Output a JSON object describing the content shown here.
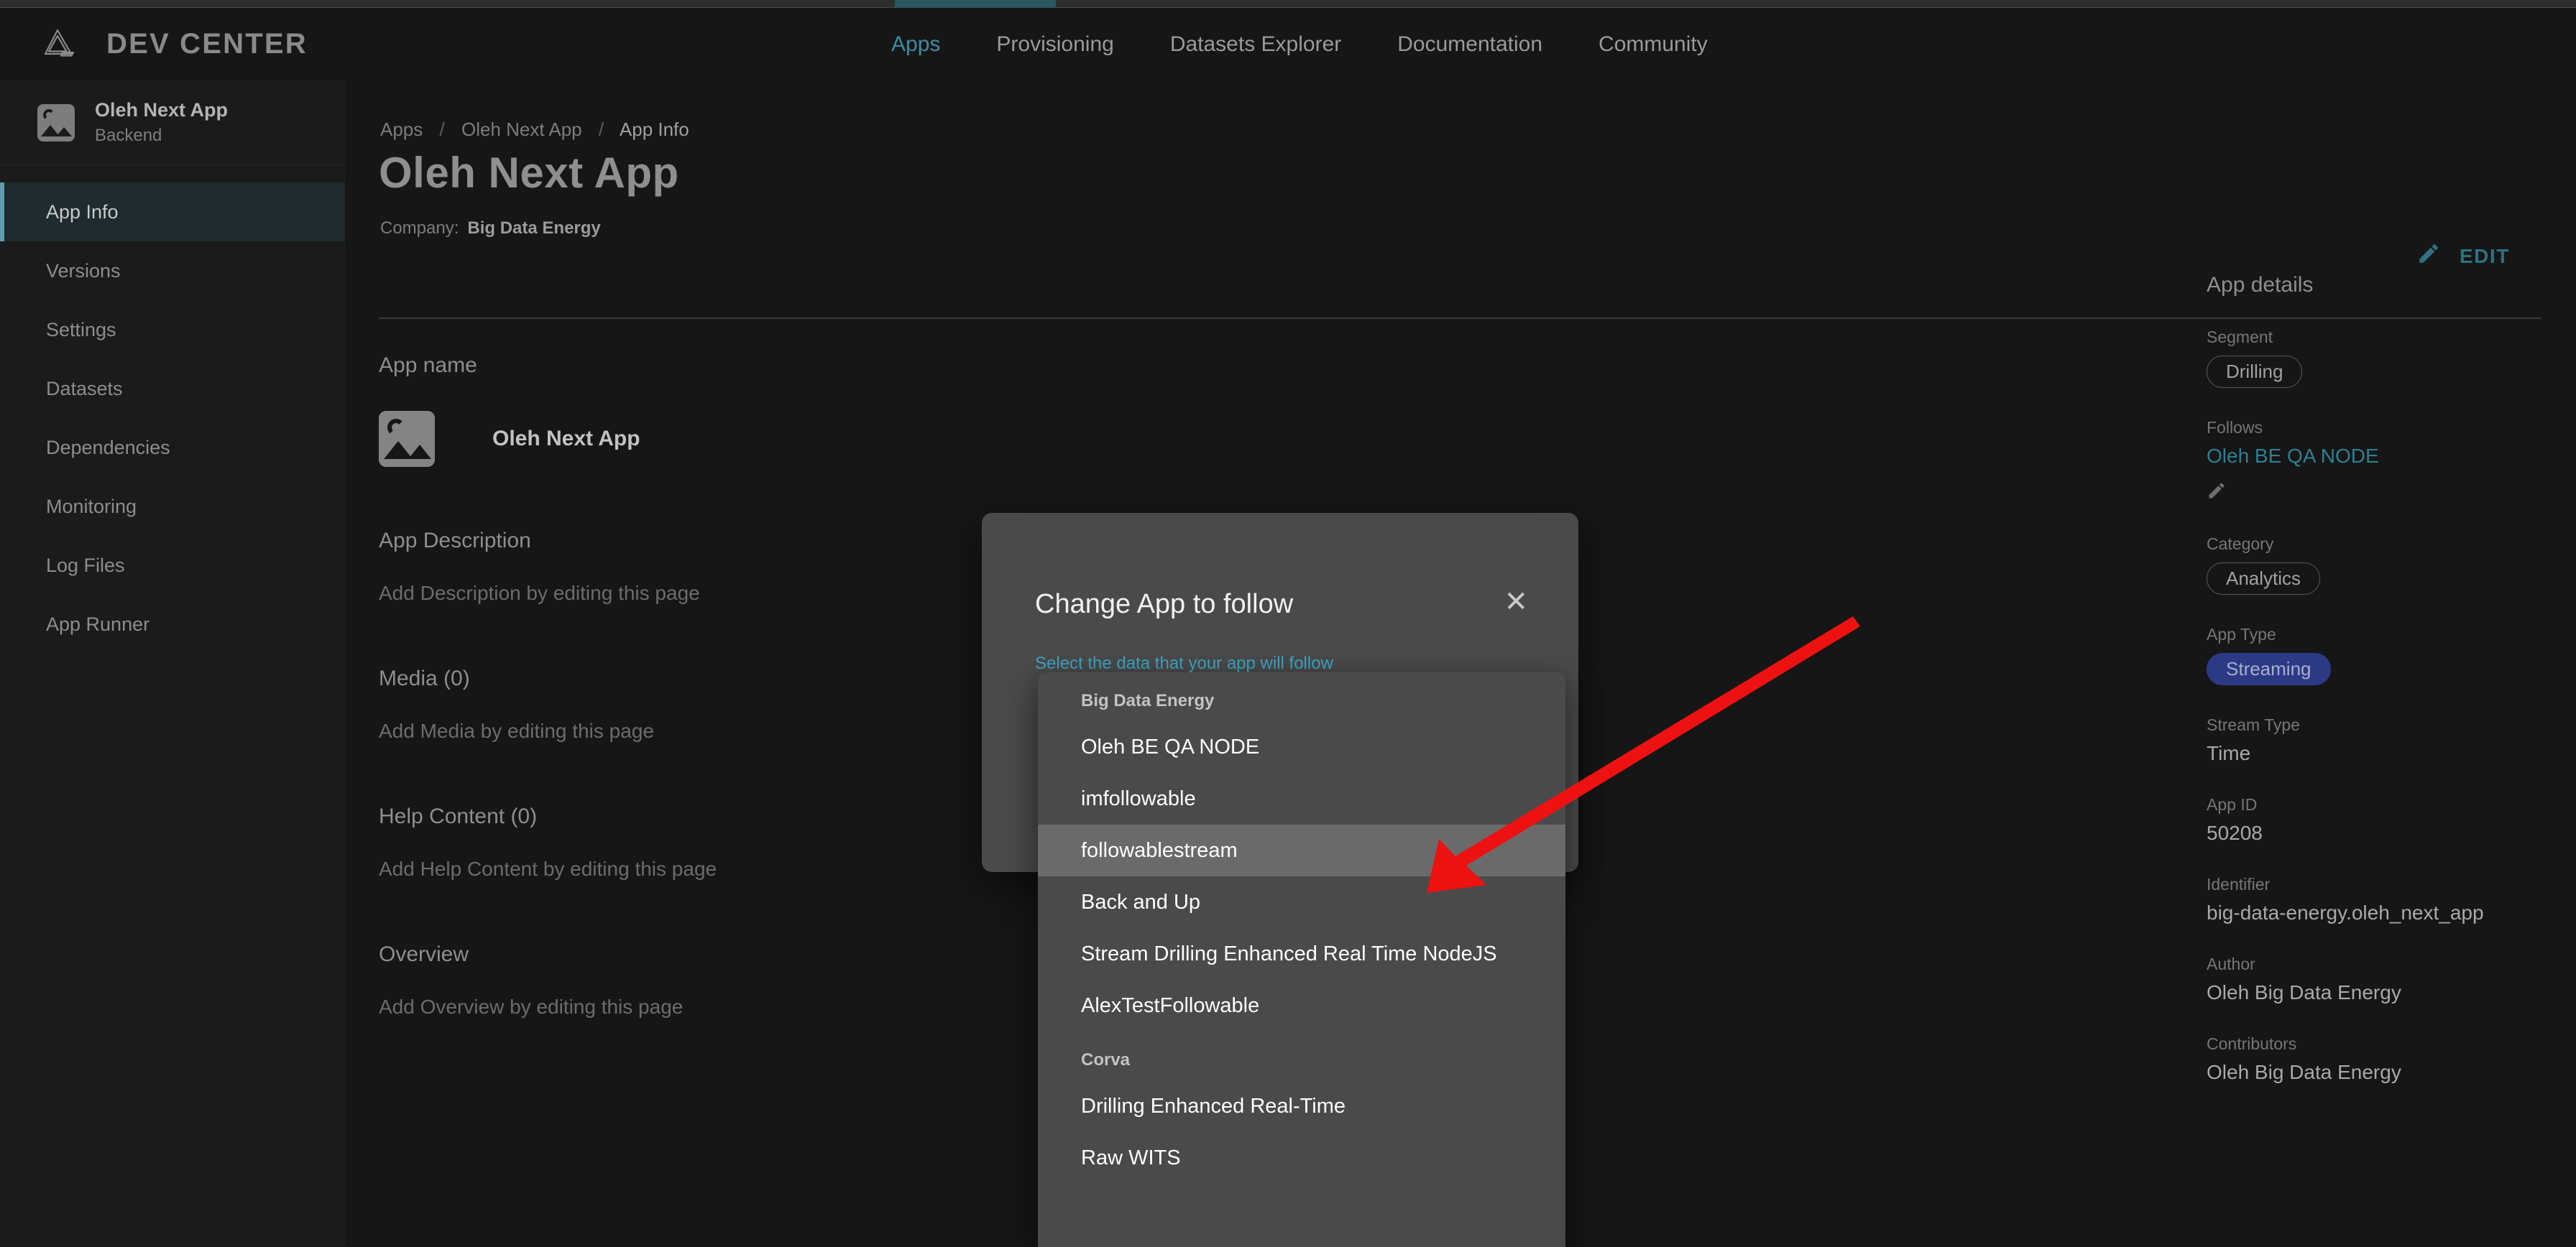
{
  "app": {
    "brand_title": "DEV CENTER",
    "logo_icon": "corva-triangle-logo-icon"
  },
  "topnav": {
    "items": [
      {
        "label": "Apps",
        "active": true
      },
      {
        "label": "Provisioning",
        "active": false
      },
      {
        "label": "Datasets Explorer",
        "active": false
      },
      {
        "label": "Documentation",
        "active": false
      },
      {
        "label": "Community",
        "active": false
      }
    ]
  },
  "sidebar": {
    "app_name": "Oleh Next App",
    "app_subtitle": "Backend",
    "app_icon": "image-placeholder-icon",
    "items": [
      {
        "label": "App Info",
        "active": true
      },
      {
        "label": "Versions",
        "active": false
      },
      {
        "label": "Settings",
        "active": false
      },
      {
        "label": "Datasets",
        "active": false
      },
      {
        "label": "Dependencies",
        "active": false
      },
      {
        "label": "Monitoring",
        "active": false
      },
      {
        "label": "Log Files",
        "active": false
      },
      {
        "label": "App Runner",
        "active": false
      }
    ]
  },
  "breadcrumb": {
    "items": [
      "Apps",
      "Oleh Next App",
      "App Info"
    ],
    "separator": "/"
  },
  "header": {
    "page_title": "Oleh Next App",
    "company_label": "Company:",
    "company_value": "Big Data Energy",
    "edit_label": "EDIT",
    "edit_icon": "pencil-icon"
  },
  "content": {
    "app_name_label": "App name",
    "app_name_value": "Oleh Next App",
    "app_icon": "image-placeholder-icon",
    "sections": [
      {
        "label": "App Description",
        "hint": "Add Description by editing this page"
      },
      {
        "label": "Media (0)",
        "hint": "Add Media by editing this page"
      },
      {
        "label": "Help Content (0)",
        "hint": "Add Help Content by editing this page"
      },
      {
        "label": "Overview",
        "hint": "Add Overview by editing this page"
      }
    ]
  },
  "details": {
    "title": "App details",
    "segment_label": "Segment",
    "segment_value": "Drilling",
    "follows_label": "Follows",
    "follows_value": "Oleh BE QA NODE",
    "follows_edit_icon": "pencil-icon",
    "category_label": "Category",
    "category_value": "Analytics",
    "app_type_label": "App Type",
    "app_type_value": "Streaming",
    "stream_type_label": "Stream Type",
    "stream_type_value": "Time",
    "app_id_label": "App ID",
    "app_id_value": "50208",
    "identifier_label": "Identifier",
    "identifier_value": "big-data-energy.oleh_next_app",
    "author_label": "Author",
    "author_value": "Oleh Big Data Energy",
    "contributors_label": "Contributors",
    "contributors_value": "Oleh Big Data Energy"
  },
  "modal": {
    "title": "Change App to follow",
    "close_icon": "close-icon",
    "subtitle": "Select the data that your app will follow"
  },
  "dropdown": {
    "groups": [
      {
        "label": "Big Data Energy",
        "items": [
          {
            "label": "Oleh BE QA NODE",
            "selected": false
          },
          {
            "label": "imfollowable",
            "selected": false
          },
          {
            "label": "followablestream",
            "selected": true
          },
          {
            "label": "Back and Up",
            "selected": false
          },
          {
            "label": "Stream Drilling Enhanced Real Time NodeJS",
            "selected": false
          },
          {
            "label": "AlexTestFollowable",
            "selected": false
          }
        ]
      },
      {
        "label": "Corva",
        "items": [
          {
            "label": "Drilling Enhanced Real-Time",
            "selected": false
          },
          {
            "label": "Raw WITS",
            "selected": false
          }
        ]
      }
    ]
  },
  "annotation": {
    "arrow_color": "#ee1111",
    "arrow_name": "red-annotation-arrow"
  },
  "colors": {
    "accent_teal": "#3b8ea5",
    "link_teal": "#2f7f93",
    "app_type_badge": "#2c3a86",
    "background": "#161616",
    "sidebar_background": "#1b1b1b",
    "modal_background": "#4a4a4a"
  }
}
